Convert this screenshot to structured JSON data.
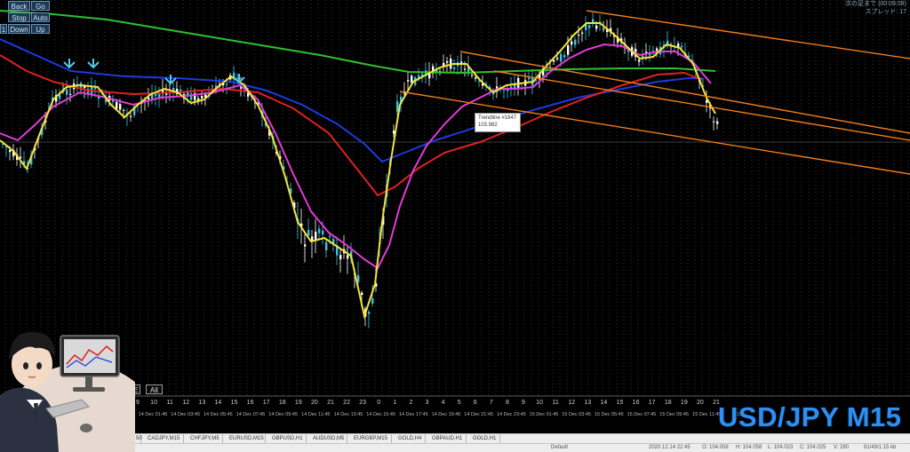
{
  "controls": {
    "back": "Back",
    "go": "Go",
    "stop": "Stop",
    "auto": "Auto",
    "one": "1",
    "down": "Down",
    "up": "Up"
  },
  "info_right": {
    "line1": "次の足まで (00:09:08)",
    "line2": "スプレッド: 17"
  },
  "tooltip": {
    "name": "Trendline #1847",
    "value": "103.982"
  },
  "buttons": {
    "fibo": "Fibo_E",
    "all": "All"
  },
  "pair_label": "USD/JPY M15",
  "axis": {
    "days": [
      "9",
      "10",
      "11",
      "12",
      "13",
      "14",
      "15",
      "16",
      "17",
      "18",
      "19",
      "20",
      "21",
      "22",
      "23",
      "0",
      "1",
      "2",
      "3",
      "4",
      "5",
      "6",
      "7",
      "8",
      "9",
      "10",
      "11",
      "12",
      "13",
      "14",
      "15",
      "16",
      "17",
      "18",
      "19",
      "20",
      "21"
    ],
    "times": [
      "14 Dec 01:45",
      "14 Dec 03:45",
      "14 Dec 05:45",
      "14 Dec 07:45",
      "14 Dec 09:45",
      "14 Dec 11:45",
      "14 Dec 13:45",
      "14 Dec 15:45",
      "14 Dec 17:45",
      "14 Dec 19:45",
      "14 Dec 21:45",
      "14 Dec 23:45",
      "15 Dec 01:45",
      "15 Dec 03:45",
      "15 Dec 05:45",
      "15 Dec 07:45",
      "15 Dec 09:45",
      "15 Dec 11:45",
      "15"
    ]
  },
  "tabs": [
    "50",
    "CADJPY,M15",
    "CHFJPY,M5",
    "EURUSD,M15",
    "GBPUSD,H1",
    "AUDUSD,M5",
    "EURGBP,M15",
    "GOLD,H4",
    "GBPAUD,H1",
    "GOLD,H1"
  ],
  "status": {
    "profile": "Default",
    "datetime": "2020.12.14 22:45",
    "open": "O: 104.058",
    "high": "H: 104.058",
    "low": "L: 104.023",
    "close": "C: 104.025",
    "volume": "V: 280",
    "traffic": "81/49/1.15 kb"
  },
  "colors": {
    "background": "#000000",
    "bull_candle": "#ffffff",
    "bear_candle": "#3ac3e6",
    "ma_yellow": "#f3e43a",
    "ma_magenta": "#e43ad8",
    "ma_red": "#e02020",
    "ma_blue": "#1d3ae0",
    "ma_green": "#2fbf2f",
    "trend_orange": "#f07c1a",
    "pair_label": "#2e8ff0"
  },
  "icons": [
    "arrow-down-signal-icon",
    "presenter-avatar-icon",
    "monitor-icon",
    "keyboard-icon",
    "mouse-icon"
  ]
}
